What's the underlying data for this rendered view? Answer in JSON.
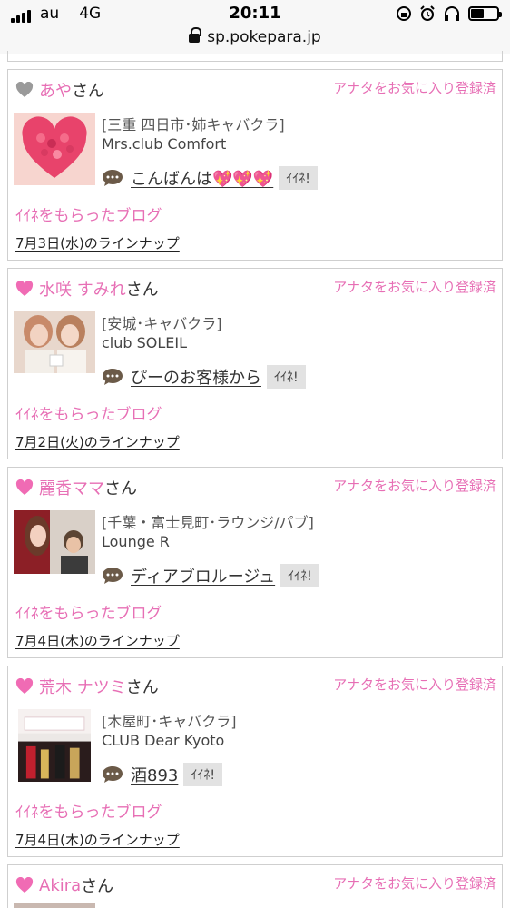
{
  "status_bar": {
    "carrier": "au",
    "network": "4G",
    "time": "20:11",
    "battery_level": 0.5
  },
  "browser": {
    "url": "sp.pokepara.jp"
  },
  "colors": {
    "accent_pink": "#e76fb5",
    "heart_grey": "#9a9a9a",
    "button_grey": "#e2e2e2"
  },
  "cards": [
    {
      "user_name": "あや",
      "suffix": "さん",
      "heart_color": "#9a9a9a",
      "favorite_status": "アナタをお気に入り登録済",
      "shop_category": "[三重 四日市･姉キャバクラ]",
      "shop_name": "Mrs.club Comfort",
      "blog_title": "こんばんは💖💖💖",
      "iine_label": "ｲｲﾈ!",
      "liked_blog_label": "ｲｲﾈをもらったブログ",
      "lineup_link": "7月3日(水)のラインナップ",
      "thumb_icon": "pink-rose-heart"
    },
    {
      "user_name": "水咲 すみれ",
      "suffix": "さん",
      "heart_color": "#f06bb4",
      "favorite_status": "アナタをお気に入り登録済",
      "shop_category": "[安城･キャバクラ]",
      "shop_name": "club SOLEIL",
      "blog_title": "ぴーのお客様から",
      "iine_label": "ｲｲﾈ!",
      "liked_blog_label": "ｲｲﾈをもらったブログ",
      "lineup_link": "7月2日(火)のラインナップ",
      "thumb_icon": "two-women-photo"
    },
    {
      "user_name": "麗香ママ",
      "suffix": "さん",
      "heart_color": "#f06bb4",
      "favorite_status": "アナタをお気に入り登録済",
      "shop_category": "[千葉・富士見町･ラウンジ/パブ]",
      "shop_name": "Lounge R",
      "blog_title": "ディアブロルージュ",
      "iine_label": "ｲｲﾈ!",
      "liked_blog_label": "ｲｲﾈをもらったブログ",
      "lineup_link": "7月4日(木)のラインナップ",
      "thumb_icon": "selfie-photo"
    },
    {
      "user_name": "荒木 ナツミ",
      "suffix": "さん",
      "heart_color": "#f06bb4",
      "favorite_status": "アナタをお気に入り登録済",
      "shop_category": "[木屋町･キャバクラ]",
      "shop_name": "CLUB Dear Kyoto",
      "blog_title": "酒893",
      "iine_label": "ｲｲﾈ!",
      "liked_blog_label": "ｲｲﾈをもらったブログ",
      "lineup_link": "7月4日(木)のラインナップ",
      "thumb_icon": "champagne-photo"
    },
    {
      "user_name": "Akira",
      "suffix": "さん",
      "heart_color": "#f06bb4",
      "favorite_status": "アナタをお気に入り登録済"
    }
  ]
}
